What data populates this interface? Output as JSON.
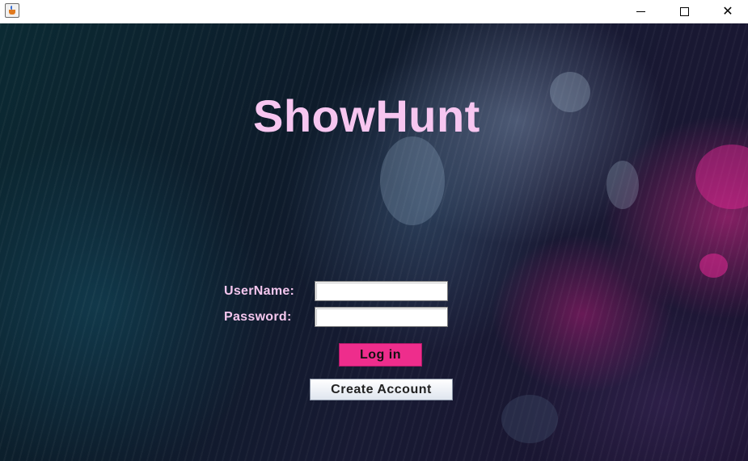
{
  "window": {
    "icon": "java-cup-icon",
    "controls": [
      "minimize-icon",
      "maximize-icon",
      "close-icon"
    ],
    "close_glyph": "✕"
  },
  "app": {
    "title": "ShowHunt"
  },
  "form": {
    "username_label": "UserName:",
    "username_value": "",
    "password_label": "Password:",
    "password_value": "",
    "login_label": "Log in",
    "create_label": "Create Account"
  },
  "colors": {
    "title": "#f7c6f0",
    "labels": "#f4c6ee",
    "login_button": "#ee2d8c",
    "create_button": "#e8edf4"
  }
}
